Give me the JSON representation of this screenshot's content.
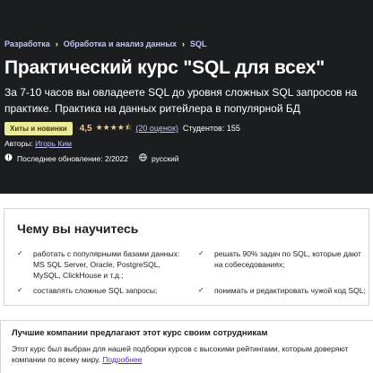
{
  "breadcrumb": {
    "items": [
      "Разработка",
      "Обработка и анализ данных",
      "SQL"
    ]
  },
  "course": {
    "title": "Практический курс \"SQL для всех\"",
    "subtitle": "За 7-10 часов вы овладеете SQL до уровня сложных SQL запросов на практике. Практика на данных ритейлера в популярной БД",
    "badge": "Хиты и новинки",
    "rating": "4,5",
    "stars": "★★★★⯪",
    "rating_count": "(20 оценок)",
    "students": "Студентов: 155",
    "authors_label": "Авторы:",
    "author": "Игорь Ким",
    "last_update": "Последнее обновление: 2/2022",
    "language": "русский"
  },
  "learn": {
    "title": "Чему вы научитесь",
    "items": [
      "работать с популярными базами данных: MS SQL Server, Oracle, PostgreSQL, MySQL, ClickHouse и т.д.;",
      "решать 90% задач по SQL, которые дают на собеседованиях;",
      "составлять сложные SQL запросы;",
      "понимать и редактировать чужой код SQL;"
    ]
  },
  "companies": {
    "title": "Лучшие компании предлагают этот курс своим сотрудникам",
    "text": "Этот курс был выбран для нашей подборки курсов с высокими рейтингами, которым доверяют компании по всему миру.",
    "link": "Подробнее"
  },
  "colors": {
    "hero_bg": "#1c1d1f",
    "breadcrumb": "#c0c4fc",
    "badge_bg": "#eceb98",
    "rating": "#f3ca8c",
    "link": "#5624d0"
  }
}
